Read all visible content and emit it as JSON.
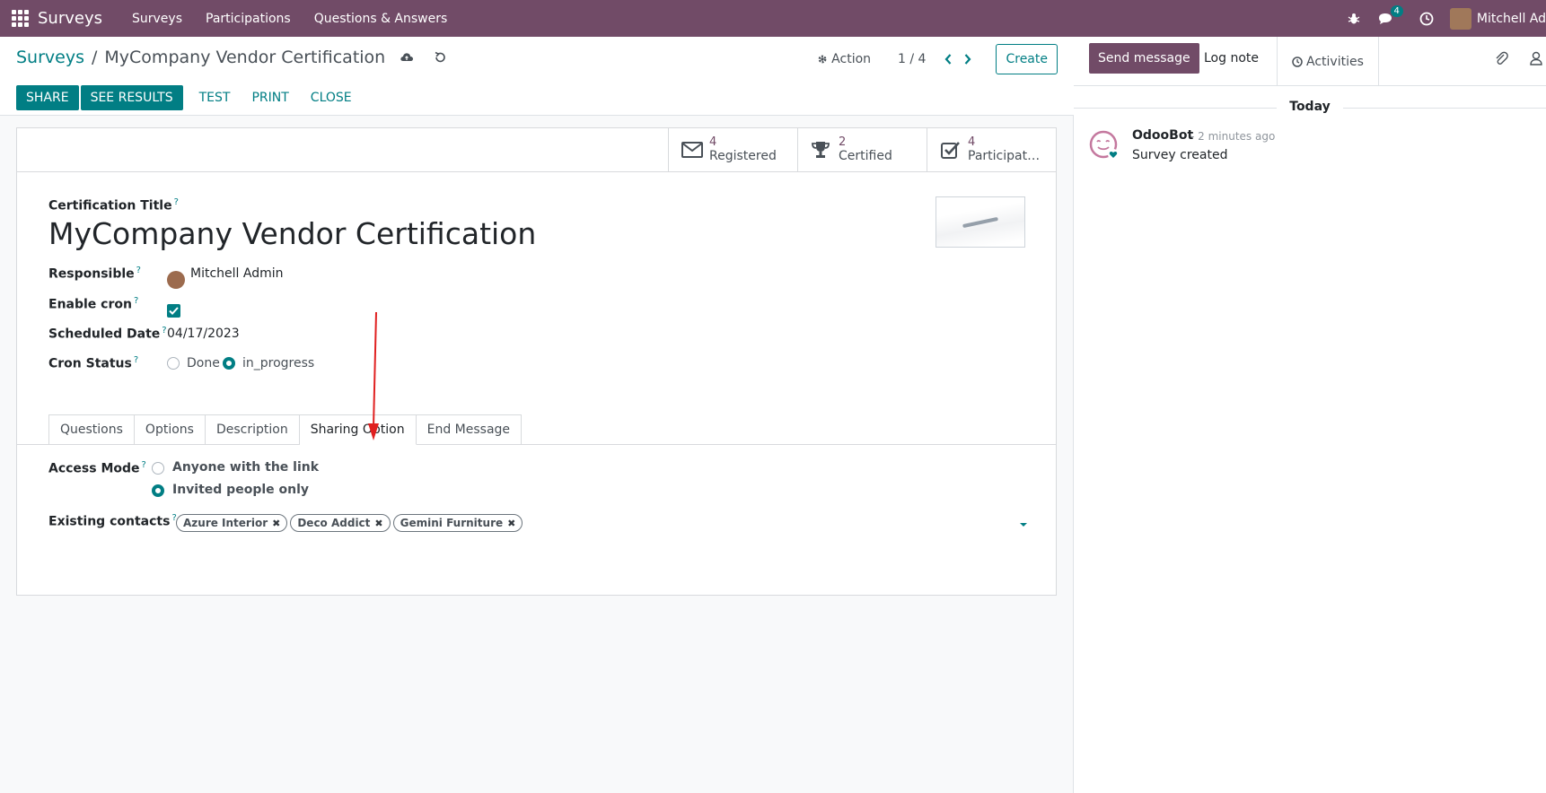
{
  "navbar": {
    "brand": "Surveys",
    "menu": [
      "Surveys",
      "Participations",
      "Questions & Answers"
    ],
    "message_count": "4",
    "user_name": "Mitchell Ad"
  },
  "breadcrumb": {
    "parent": "Surveys",
    "separator": "/",
    "current": "MyCompany Vendor Certification"
  },
  "control_panel": {
    "action_label": "Action",
    "pager": "1 / 4",
    "create_label": "Create",
    "buttons": {
      "share": "SHARE",
      "see_results": "SEE RESULTS",
      "test": "TEST",
      "print": "PRINT",
      "close": "CLOSE"
    }
  },
  "stat_buttons": [
    {
      "count": "4",
      "label": "Registered",
      "icon": "envelope-icon"
    },
    {
      "count": "2",
      "label": "Certified",
      "icon": "trophy-icon"
    },
    {
      "count": "4",
      "label": "Participat…",
      "icon": "check-square-icon"
    }
  ],
  "form": {
    "title_label": "Certification Title",
    "title_value": "MyCompany Vendor Certification",
    "help_mark": "?",
    "responsible_label": "Responsible",
    "responsible_value": "Mitchell Admin",
    "enable_cron_label": "Enable cron",
    "enable_cron_value": true,
    "scheduled_date_label": "Scheduled Date",
    "scheduled_date_value": "04/17/2023",
    "cron_status_label": "Cron Status",
    "cron_status_options": [
      "Done",
      "in_progress"
    ],
    "cron_status_selected": "in_progress"
  },
  "tabs": [
    "Questions",
    "Options",
    "Description",
    "Sharing Option",
    "End Message"
  ],
  "active_tab": "Sharing Option",
  "sharing": {
    "access_mode_label": "Access Mode",
    "access_mode_options": [
      "Anyone with the link",
      "Invited people only"
    ],
    "access_mode_selected": "Invited people only",
    "existing_contacts_label": "Existing contacts",
    "contacts": [
      "Azure Interior",
      "Deco Addict",
      "Gemini Furniture"
    ],
    "remove_mark": "✖"
  },
  "chatter": {
    "send_message": "Send message",
    "log_note": "Log note",
    "activities": "Activities",
    "date_separator": "Today",
    "messages": [
      {
        "author": "OdooBot",
        "time": "- 2 minutes ago",
        "body": "Survey created"
      }
    ]
  },
  "colors": {
    "navbar": "#714b67",
    "primary": "#017e84",
    "annotation_arrow": "#e02020"
  }
}
